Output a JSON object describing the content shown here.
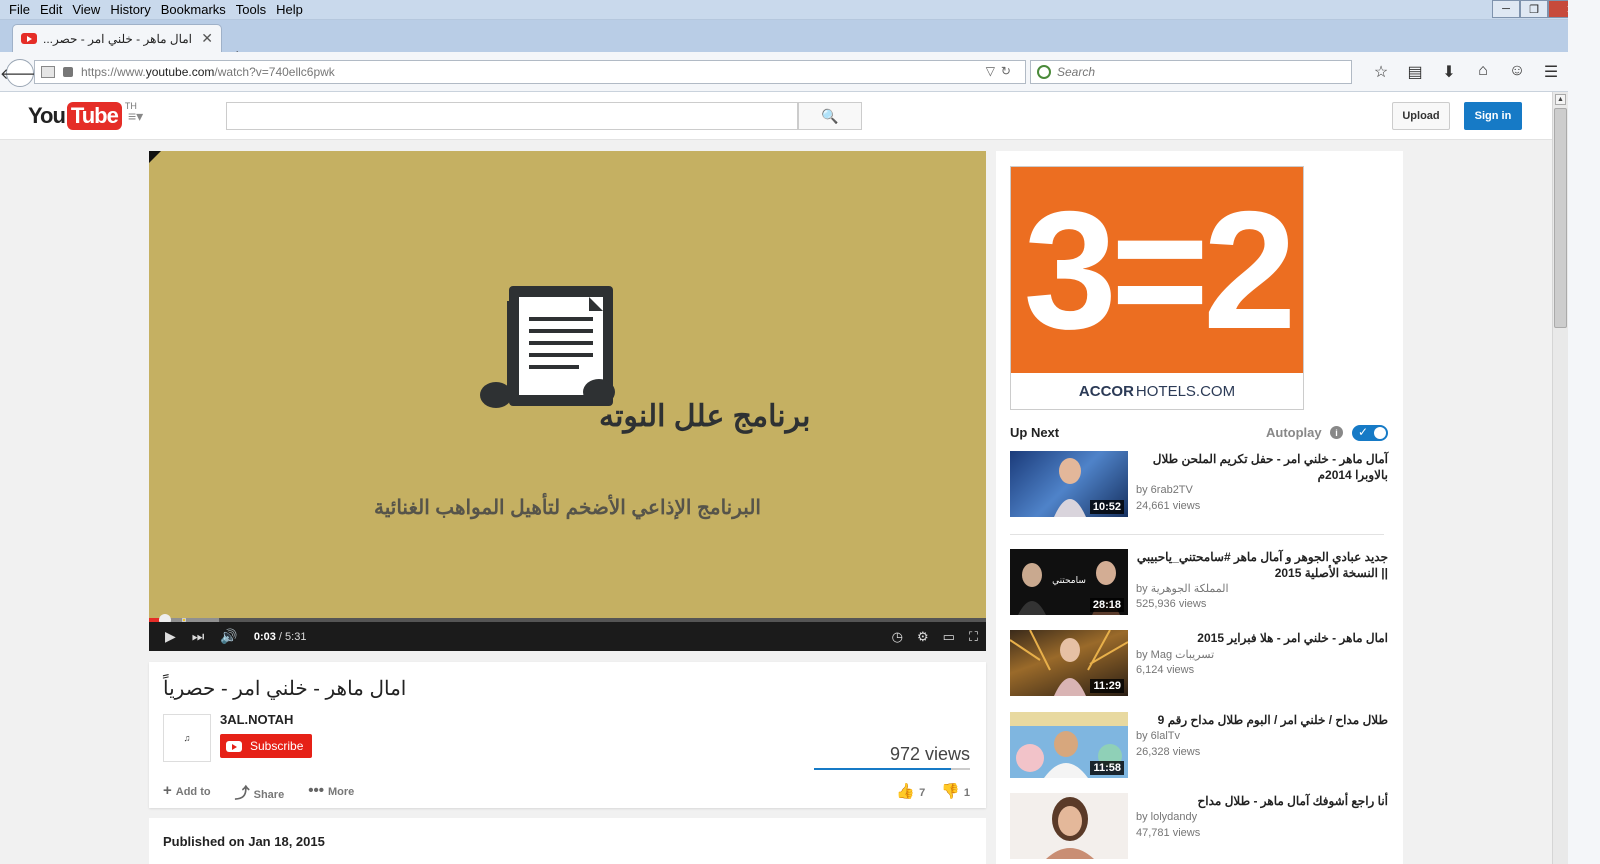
{
  "browser": {
    "menu": [
      "File",
      "Edit",
      "View",
      "History",
      "Bookmarks",
      "Tools",
      "Help"
    ],
    "tab_title": "امال ماهر - خلني امر - حصر...",
    "url_prefix": "https://www.",
    "url_domain": "youtube.com",
    "url_path": "/watch?v=740ellc6pwk",
    "search_placeholder": "Search"
  },
  "masthead": {
    "logo_you": "You",
    "logo_tube": "Tube",
    "country": "TH",
    "upload_label": "Upload",
    "signin_label": "Sign in"
  },
  "player": {
    "art_program_name": "برنامج علل النوته",
    "art_tagline": "البرنامج الإذاعي الأضخم لتأهيل المواهب الغنائية",
    "time_current": "0:03",
    "time_total": "/ 5:31",
    "played_fraction": 0.01
  },
  "video": {
    "title": "امال ماهر - خلني امر - حصرياً",
    "channel": "3AL.NOTAH",
    "subscribe_label": "Subscribe",
    "views": "972 views",
    "actions": [
      "Add to",
      "Share",
      "More"
    ],
    "likes": "7",
    "dislikes": "1",
    "like_ratio": 0.88,
    "published": "Published on Jan 18, 2015"
  },
  "ad": {
    "headline": "3=2",
    "brand_bold": "ACCOR",
    "brand_rest": "HOTELS.COM",
    "bg_color": "#ec6e21"
  },
  "sidebar": {
    "up_next": "Up Next",
    "autoplay": "Autoplay",
    "items": [
      {
        "title": "آمال ماهر - خلني امر - حفل تكريم الملحن طلال بالاوبرا 2014م",
        "by": "by 6rab2TV",
        "views": "24,661 views",
        "duration": "10:52"
      },
      {
        "title": "جديد عبادي الجوهر و آمال ماهر #سامحتني_ياحبيبي || النسخة الأصلية 2015",
        "by": "by المملكة الجوهرية",
        "views": "525,936 views",
        "duration": "28:18"
      },
      {
        "title": "امال ماهر - خلني امر - هلا فبراير 2015",
        "by": "by Mag تسريبات",
        "views": "6,124 views",
        "duration": "11:29"
      },
      {
        "title": "طلال مداح / خلني امر / البوم طلال مداح رقم 9",
        "by": "by 6lalTv",
        "views": "26,328 views",
        "duration": "11:58"
      },
      {
        "title": "أنا راجع أشوفك آمال ماهر - طلال مداح",
        "by": "by lolydandy",
        "views": "47,781 views",
        "duration": ""
      }
    ]
  }
}
